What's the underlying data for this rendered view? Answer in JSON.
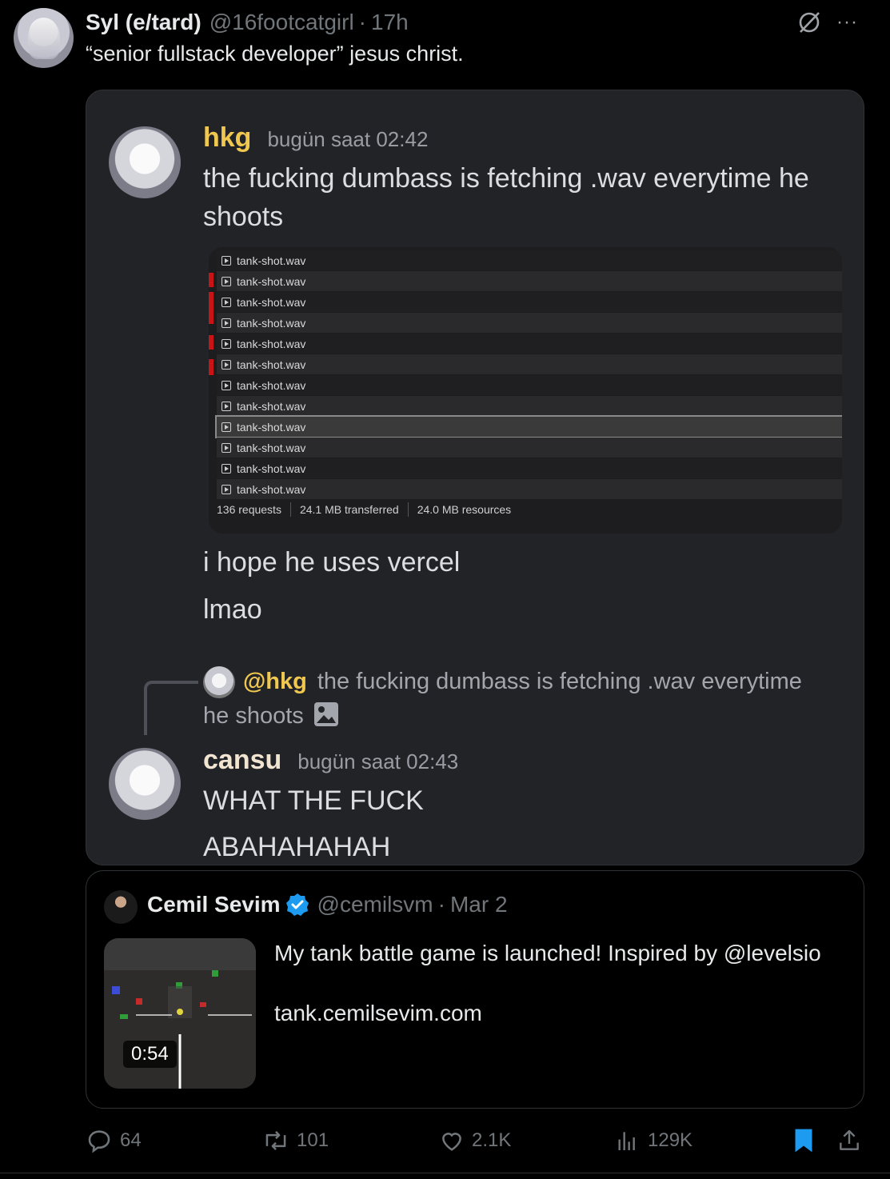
{
  "tweet": {
    "author_name": "Syl (e/tard)",
    "handle": "@16footcatgirl",
    "separator": "·",
    "time": "17h",
    "text": "“senior fullstack developer” jesus christ.",
    "more_label": "···"
  },
  "discord": {
    "msg1": {
      "author": "hkg",
      "author_color": "#f0c850",
      "time": "bugün saat 02:42",
      "line1": "the fucking dumbass is fetching .wav everytime he",
      "line2": "shoots",
      "followup1": "i hope he uses vercel",
      "followup2": "lmao"
    },
    "network": {
      "files": [
        "tank-shot.wav",
        "tank-shot.wav",
        "tank-shot.wav",
        "tank-shot.wav",
        "tank-shot.wav",
        "tank-shot.wav",
        "tank-shot.wav",
        "tank-shot.wav",
        "tank-shot.wav",
        "tank-shot.wav",
        "tank-shot.wav",
        "tank-shot.wav"
      ],
      "requests": "136 requests",
      "transferred": "24.1 MB transferred",
      "resources": "24.0 MB resources"
    },
    "reply": {
      "mention": "@hkg",
      "line1": "the fucking dumbass is fetching .wav everytime",
      "line2": "he shoots"
    },
    "msg2": {
      "author": "cansu",
      "author_color": "#f1e4d0",
      "time": "bugün saat 02:43",
      "line1": "WHAT THE FUCK",
      "line2": "ABAHAHAHAH"
    }
  },
  "quote": {
    "name": "Cemil Sevim",
    "handle": "@cemilsvm",
    "separator": "·",
    "date": "Mar 2",
    "text1": "My tank battle game is launched! Inspired by @levelsio",
    "text2": "tank.cemilsevim.com",
    "video_duration": "0:54"
  },
  "actions": {
    "replies": "64",
    "reposts": "101",
    "likes": "2.1K",
    "views": "129K"
  },
  "colors": {
    "accent": "#1d9bf0",
    "background": "#000000",
    "muted": "#71767b"
  }
}
